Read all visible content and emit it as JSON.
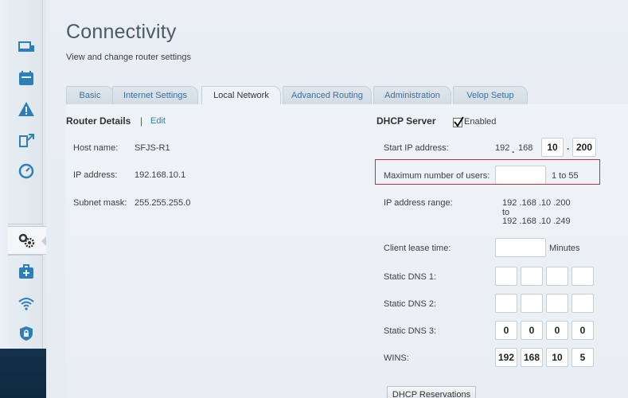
{
  "page": {
    "title": "Connectivity",
    "subtitle": "View and change router settings"
  },
  "tabs": [
    {
      "label": "Basic"
    },
    {
      "label": "Internet Settings"
    },
    {
      "label": "Local Network"
    },
    {
      "label": "Advanced Routing"
    },
    {
      "label": "Administration"
    },
    {
      "label": "Velop Setup"
    }
  ],
  "router_details": {
    "title": "Router Details",
    "separator": "|",
    "edit_label": "Edit",
    "host_name_label": "Host name:",
    "host_name_value": "SFJS-R1",
    "ip_label": "IP address:",
    "ip_value": "192.168.10.1",
    "subnet_label": "Subnet mask:",
    "subnet_value": "255.255.255.0"
  },
  "dhcp": {
    "title": "DHCP Server",
    "enabled_label": "Enabled",
    "start_ip_label": "Start IP address:",
    "start_ip_prefix": [
      "192",
      "168"
    ],
    "start_ip_fields": [
      "10",
      "200"
    ],
    "max_users_label": "Maximum number of users:",
    "max_users_value": "",
    "max_users_range": "1 to 55",
    "range_label": "IP address range:",
    "range_start": "192 .168 .10 .200",
    "range_to": "to",
    "range_end": "192 .168 .10 .249",
    "lease_label": "Client lease time:",
    "lease_value": "",
    "lease_unit": "Minutes",
    "dns1_label": "Static DNS 1:",
    "dns1": [
      "",
      "",
      "",
      ""
    ],
    "dns2_label": "Static DNS 2:",
    "dns2": [
      "",
      "",
      "",
      ""
    ],
    "dns3_label": "Static DNS 3:",
    "dns3": [
      "0",
      "0",
      "0",
      "0"
    ],
    "wins_label": "WINS:",
    "wins": [
      "192",
      "168",
      "10",
      "5"
    ],
    "reservations_button": "DHCP Reservations"
  },
  "colors": {
    "accent": "#2f7fb7",
    "highlight": "#b8343a"
  }
}
